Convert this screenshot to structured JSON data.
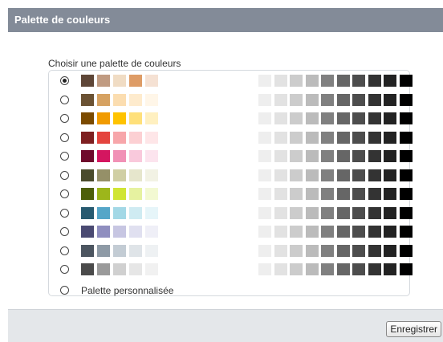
{
  "dialog": {
    "title": "Palette de couleurs",
    "legend": "Choisir une palette de couleurs",
    "custom_label": "Palette personnalisée",
    "save_label": "Enregistrer"
  },
  "palettes": [
    {
      "name": "brown",
      "selected": true,
      "colors": [
        "#5E4637",
        "#C09B82",
        "#F0DCC4",
        "#DE9C66",
        "#F5E1D3"
      ]
    },
    {
      "name": "tan",
      "selected": false,
      "colors": [
        "#6B5233",
        "#D6A262",
        "#FBDDB0",
        "#FEEBCD",
        "#FFF6E8"
      ]
    },
    {
      "name": "orange",
      "selected": false,
      "colors": [
        "#7B4A00",
        "#F19B00",
        "#FFC300",
        "#FFE07A",
        "#FFF0C0"
      ]
    },
    {
      "name": "red",
      "selected": false,
      "colors": [
        "#7E1F20",
        "#E4443E",
        "#F7A6AA",
        "#FCD0D3",
        "#FEE6E8"
      ]
    },
    {
      "name": "pink",
      "selected": false,
      "colors": [
        "#6F0A2C",
        "#D41660",
        "#F191B6",
        "#F9C9DC",
        "#FCE4EE"
      ]
    },
    {
      "name": "olive",
      "selected": false,
      "colors": [
        "#4A4B2C",
        "#959068",
        "#D0CFA4",
        "#E6E6CC",
        "#F2F2E4"
      ]
    },
    {
      "name": "green",
      "selected": false,
      "colors": [
        "#4D5F0A",
        "#9DB61B",
        "#D0E534",
        "#E6F2A0",
        "#F3F9D2"
      ]
    },
    {
      "name": "teal",
      "selected": false,
      "colors": [
        "#275A70",
        "#55A6C8",
        "#A3D8E6",
        "#CFEBF2",
        "#E6F5F9"
      ]
    },
    {
      "name": "purple",
      "selected": false,
      "colors": [
        "#4A4A72",
        "#8F8EBF",
        "#C7C6E2",
        "#E0E0F0",
        "#EFEFF7"
      ]
    },
    {
      "name": "slate",
      "selected": false,
      "colors": [
        "#4C5560",
        "#8E9AA6",
        "#C3CCD4",
        "#DFE4E8",
        "#EEF1F3"
      ]
    },
    {
      "name": "gray",
      "selected": false,
      "colors": [
        "#4A4A4A",
        "#9A9A9A",
        "#D0D0D0",
        "#E6E6E6",
        "#F1F1F1"
      ]
    }
  ],
  "gray_scale": [
    "#EEEEEE",
    "#E2E2E2",
    "#CCCCCC",
    "#BBBBBB",
    "#808080",
    "#666666",
    "#4D4D4D",
    "#333333",
    "#222222",
    "#000000"
  ]
}
